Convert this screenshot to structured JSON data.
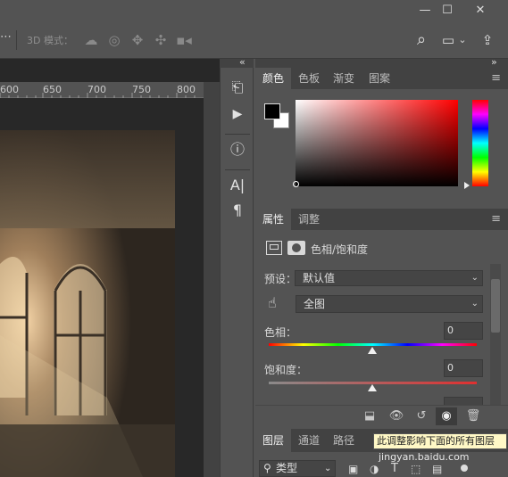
{
  "window": {
    "min_label": "—",
    "max_label": "☐",
    "close_label": "✕"
  },
  "options_bar": {
    "ellipsis": "⋯",
    "mode_label": "3D 模式：",
    "icons": [
      "rotate-3d-icon",
      "roll-3d-icon",
      "pan-3d-icon",
      "slide-3d-icon",
      "scale-3d-icon"
    ],
    "search_glyph": "⌕",
    "workspace_glyph": "▭",
    "workspace_chevron": "⌄",
    "share_glyph": "⇪"
  },
  "ruler": {
    "ticks": [
      "600",
      "650",
      "700",
      "750",
      "800"
    ]
  },
  "collapse_glyph": "«",
  "expand_glyph": "»",
  "tool_strip": {
    "history_glyph": "⎗",
    "play_glyph": "▶",
    "info_glyph": "ⓘ",
    "character_glyph": "A|",
    "paragraph_glyph": "¶"
  },
  "color_panel": {
    "tabs": [
      "颜色",
      "色板",
      "渐变",
      "图案"
    ],
    "active_tab": 0,
    "menu_glyph": "≡",
    "foreground": "#000000",
    "background": "#ffffff",
    "hue_color": "#ff0000"
  },
  "properties_panel": {
    "tabs": [
      "属性",
      "调整"
    ],
    "active_tab": 0,
    "menu_glyph": "≡",
    "title": "色相/饱和度",
    "preset_label": "预设：",
    "preset_value": "默认值",
    "channel_value": "全图",
    "hue_label": "色相：",
    "hue_value": "0",
    "saturation_label": "饱和度：",
    "saturation_value": "0"
  },
  "footer_icons": [
    "clip-to-layer-icon",
    "view-previous-icon",
    "reset-icon",
    "visibility-icon",
    "delete-icon"
  ],
  "layers_panel": {
    "tabs": [
      "图层",
      "通道",
      "路径"
    ],
    "active_tab": 0,
    "filter_label": "类型"
  },
  "tooltip": "此调整影响下面的所有图层",
  "watermark": "jingyan.baidu.com"
}
